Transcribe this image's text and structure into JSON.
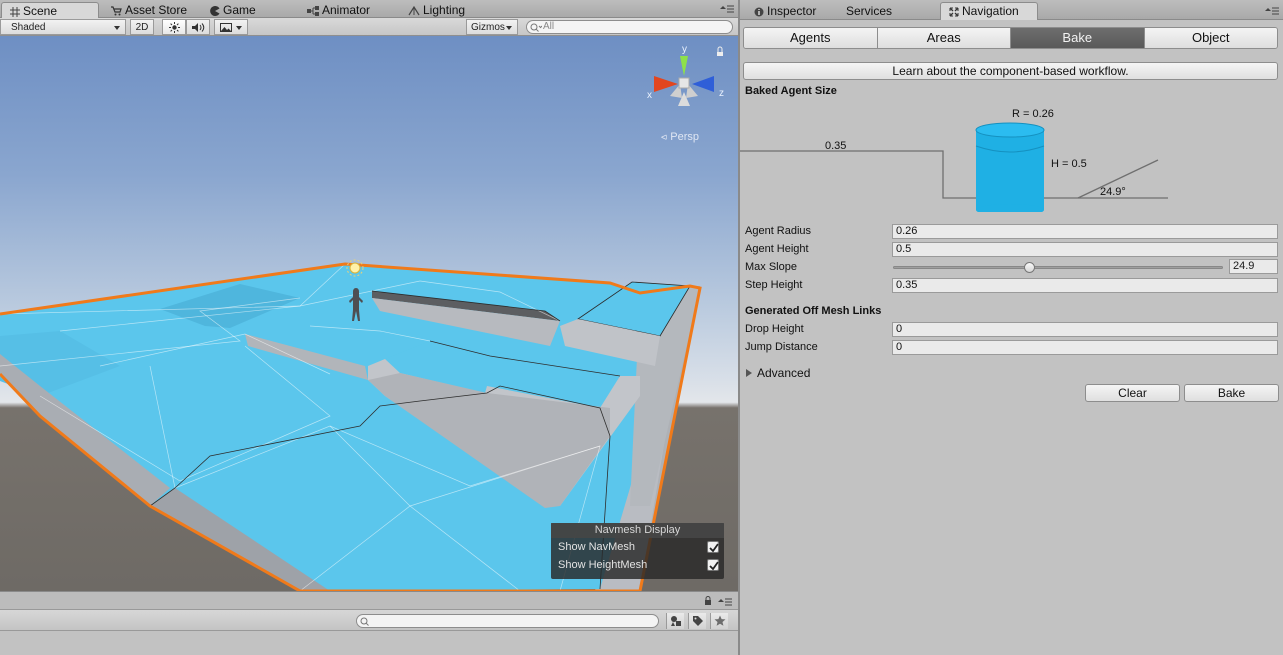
{
  "left_tabs": [
    {
      "label": "Scene",
      "icon": "grid-icon",
      "active": true
    },
    {
      "label": "Asset Store",
      "icon": "cart-icon",
      "active": false
    },
    {
      "label": "Game",
      "icon": "pacman-icon",
      "active": false
    },
    {
      "label": "Animator",
      "icon": "animator-icon",
      "active": false
    },
    {
      "label": "Lighting",
      "icon": "lighting-icon",
      "active": false
    }
  ],
  "scene_toolbar": {
    "draw_mode": "Shaded",
    "mode_2d": "2D",
    "gizmos": "Gizmos",
    "search_placeholder": "All"
  },
  "viewport": {
    "projection": "Persp",
    "axes": {
      "x": "x",
      "y": "y",
      "z": "z"
    },
    "navmesh_display": {
      "title": "Navmesh Display",
      "show_navmesh": {
        "label": "Show NavMesh",
        "checked": true
      },
      "show_heightmesh": {
        "label": "Show HeightMesh",
        "checked": true
      }
    }
  },
  "right_tabs": [
    {
      "label": "Inspector",
      "icon": "info-icon",
      "active": false
    },
    {
      "label": "Services",
      "icon": "cloud-icon",
      "active": false
    },
    {
      "label": "Navigation",
      "icon": "navigation-icon",
      "active": true
    }
  ],
  "navigation": {
    "segments": [
      "Agents",
      "Areas",
      "Bake",
      "Object"
    ],
    "active_segment": "Bake",
    "learn_button": "Learn about the component-based workflow.",
    "baked_agent_size_title": "Baked Agent Size",
    "diagram": {
      "radius_label": "R = 0.26",
      "height_label": "H = 0.5",
      "step_label": "0.35",
      "slope_label": "24.9°"
    },
    "agent_radius": {
      "label": "Agent Radius",
      "value": "0.26"
    },
    "agent_height": {
      "label": "Agent Height",
      "value": "0.5"
    },
    "max_slope": {
      "label": "Max Slope",
      "value": "24.9",
      "fraction": 0.415
    },
    "step_height": {
      "label": "Step Height",
      "value": "0.35"
    },
    "offmesh_title": "Generated Off Mesh Links",
    "drop_height": {
      "label": "Drop Height",
      "value": "0"
    },
    "jump_distance": {
      "label": "Jump Distance",
      "value": "0"
    },
    "advanced_label": "Advanced",
    "clear_button": "Clear",
    "bake_button": "Bake"
  },
  "colors": {
    "navmesh": "#5bc6ec",
    "outline": "#f07a1a",
    "active_segment": "#626262",
    "agent_cylinder": "#1fb0e4"
  }
}
